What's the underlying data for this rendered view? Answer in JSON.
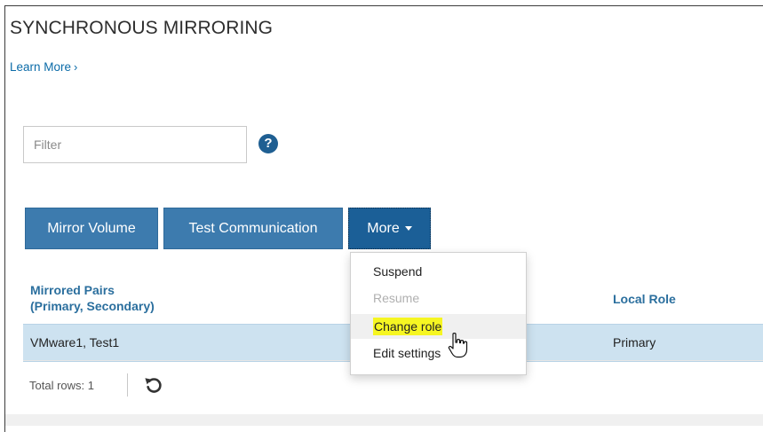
{
  "page": {
    "title": "SYNCHRONOUS MIRRORING",
    "learn_more": "Learn More",
    "learn_more_chevron": "›"
  },
  "filter": {
    "placeholder": "Filter",
    "value": ""
  },
  "help": {
    "icon": "question-circle-icon",
    "glyph": "?"
  },
  "toolbar": {
    "mirror_volume": "Mirror Volume",
    "test_communication": "Test Communication",
    "more": "More"
  },
  "more_menu": {
    "items": [
      {
        "label": "Suspend",
        "enabled": true
      },
      {
        "label": "Resume",
        "enabled": false
      },
      {
        "label": "Change role",
        "enabled": true,
        "highlighted": true
      },
      {
        "label": "Edit settings",
        "enabled": true
      }
    ]
  },
  "table": {
    "columns": {
      "mirrored_pairs_line1": "Mirrored Pairs",
      "mirrored_pairs_line2": "(Primary, Secondary)",
      "local_role": "Local Role"
    },
    "rows": [
      {
        "pairs": "VMware1, Test1",
        "local_role": "Primary",
        "selected": true
      }
    ]
  },
  "footer": {
    "total_rows": "Total rows: 1",
    "refresh_icon": "refresh-icon"
  },
  "colors": {
    "primary_button": "#3d7bae",
    "active_button": "#1b5f97",
    "link": "#0b6ba8",
    "header_text": "#2b6f9e",
    "selected_row": "#cde2f0",
    "highlight": "#f6f622"
  }
}
